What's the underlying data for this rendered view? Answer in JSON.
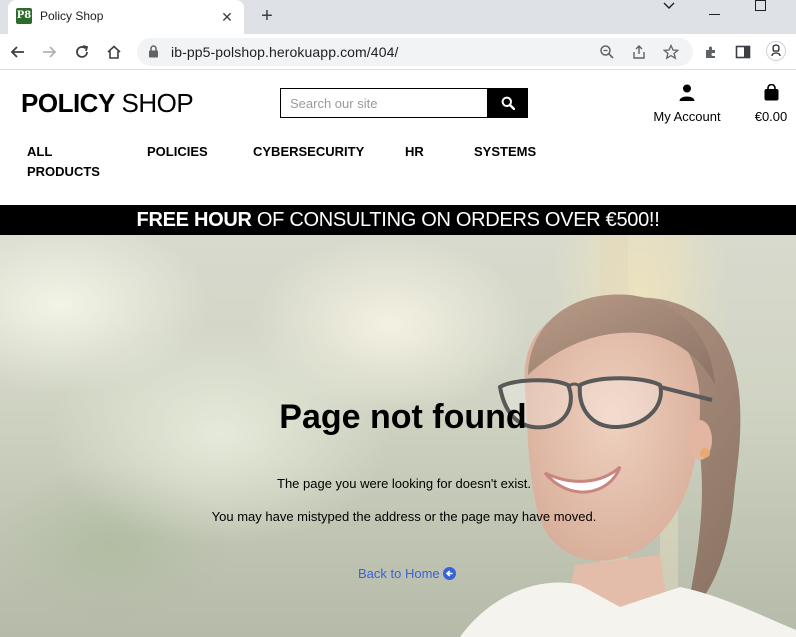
{
  "browser": {
    "tab_title": "Policy Shop",
    "favicon_text": "P8",
    "url": "ib-pp5-polshop.herokuapp.com/404/"
  },
  "site": {
    "logo_bold": "POLICY",
    "logo_regular": " SHOP",
    "search_placeholder": "Search our site",
    "account_label": "My Account",
    "bag_total": "€0.00",
    "nav": [
      {
        "label": "ALL"
      },
      {
        "label": "PRODUCTS"
      },
      {
        "label": "POLICIES"
      },
      {
        "label": "CYBERSECURITY"
      },
      {
        "label": "HR"
      },
      {
        "label": "SYSTEMS"
      }
    ],
    "banner_bold": "FREE HOUR",
    "banner_regular": " OF CONSULTING ON ORDERS OVER €500!!"
  },
  "page": {
    "title": "Page not found",
    "message_1": "The page you were looking for doesn't exist.",
    "message_2": "You may have mistyped the address or the page may have moved.",
    "home_link": "Back to Home"
  },
  "colors": {
    "link": "#3a62d8",
    "banner_bg": "#000000",
    "favicon_bg": "#2d6b2d"
  }
}
